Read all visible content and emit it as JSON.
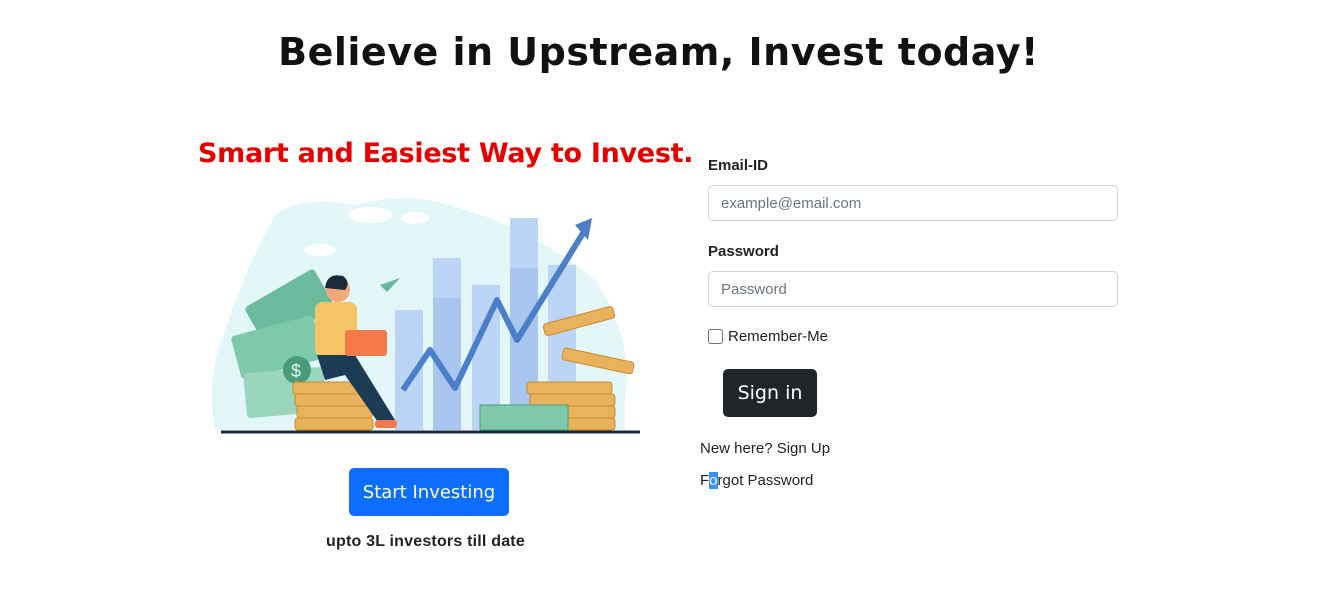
{
  "header": {
    "title": "Believe in Upstream, Invest today!"
  },
  "hero": {
    "tagline": "Smart and Easiest Way to Invest.",
    "cta_label": "Start Investing",
    "investors_text": "upto 3L investors till date",
    "colors": {
      "tagline": "#e60000",
      "cta": "#0d6efd"
    }
  },
  "login": {
    "email": {
      "label": "Email-ID",
      "placeholder": "example@email.com",
      "value": ""
    },
    "password": {
      "label": "Password",
      "placeholder": "Password",
      "value": ""
    },
    "remember_label": "Remember-Me",
    "remember_checked": false,
    "signin_label": "Sign in",
    "signup_text": "New here? Sign Up",
    "forgot": {
      "before": "F",
      "selected": "o",
      "after": "rgot Password"
    },
    "colors": {
      "signin": "#212529"
    }
  }
}
